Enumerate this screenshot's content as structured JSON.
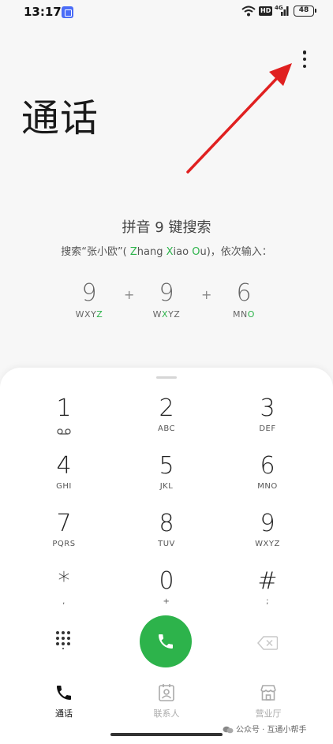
{
  "status_bar": {
    "time": "13:17",
    "hd_label": "HD",
    "network_label": "4G",
    "battery": "48"
  },
  "page_title": "通话",
  "hint": {
    "title": "拼音 9 键搜索",
    "desc_prefix": "搜索“张小欧”( ",
    "z": "Z",
    "hang": "hang ",
    "x": "X",
    "iao": "iao ",
    "o": "O",
    "u": "u",
    "desc_suffix": ")，依次输入："
  },
  "example": [
    {
      "digit": "9",
      "letters_pre": "WXY",
      "letters_hl": "Z",
      "letters_post": ""
    },
    {
      "digit": "9",
      "letters_pre": "W",
      "letters_hl": "X",
      "letters_post": "YZ"
    },
    {
      "digit": "6",
      "letters_pre": "MN",
      "letters_hl": "O",
      "letters_post": ""
    }
  ],
  "plus": "+",
  "dialpad": [
    {
      "digit": "1",
      "letters": ""
    },
    {
      "digit": "2",
      "letters": "ABC"
    },
    {
      "digit": "3",
      "letters": "DEF"
    },
    {
      "digit": "4",
      "letters": "GHI"
    },
    {
      "digit": "5",
      "letters": "JKL"
    },
    {
      "digit": "6",
      "letters": "MNO"
    },
    {
      "digit": "7",
      "letters": "PQRS"
    },
    {
      "digit": "8",
      "letters": "TUV"
    },
    {
      "digit": "9",
      "letters": "WXYZ"
    },
    {
      "digit": "*",
      "letters": ","
    },
    {
      "digit": "0",
      "letters": "+"
    },
    {
      "digit": "#",
      "letters": ";"
    }
  ],
  "bottom_nav": {
    "calls": "通话",
    "contacts": "联系人",
    "store": "营业厅"
  },
  "watermark": "公众号 · 互通小帮手",
  "colors": {
    "accent_green": "#2db34b",
    "annotation_red": "#e02020"
  }
}
